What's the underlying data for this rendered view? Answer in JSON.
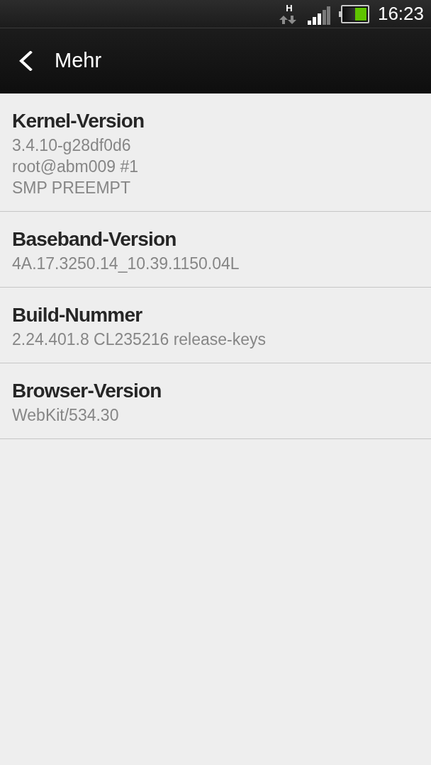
{
  "status_bar": {
    "network_type": "H",
    "time": "16:23",
    "battery": {
      "level": 0.5
    }
  },
  "header": {
    "title": "Mehr"
  },
  "items": [
    {
      "title": "Kernel-Version",
      "value": "3.4.10-g28df0d6\nroot@abm009 #1\nSMP PREEMPT"
    },
    {
      "title": "Baseband-Version",
      "value": "4A.17.3250.14_10.39.1150.04L"
    },
    {
      "title": "Build-Nummer",
      "value": "2.24.401.8 CL235216 release-keys"
    },
    {
      "title": "Browser-Version",
      "value": "WebKit/534.30"
    }
  ]
}
